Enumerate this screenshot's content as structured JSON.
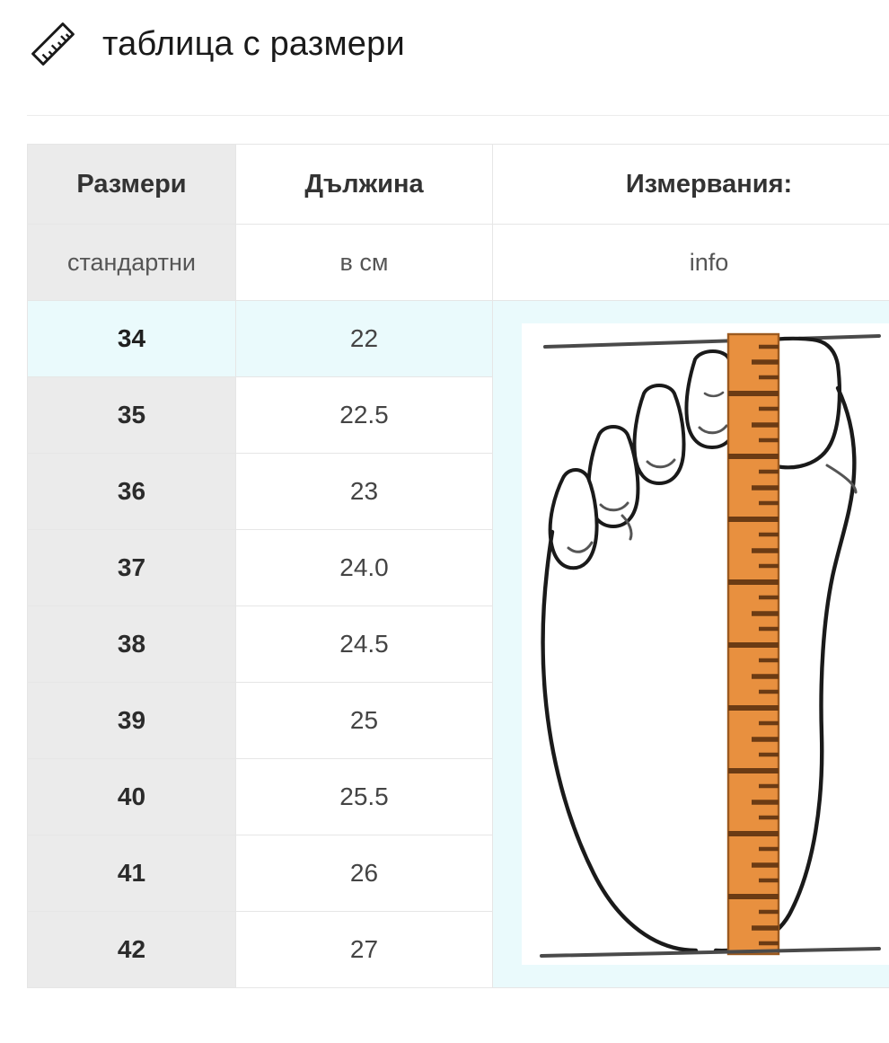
{
  "header": {
    "icon": "ruler-icon",
    "title": "таблица с размери"
  },
  "colors": {
    "highlight_row": "#eafafc",
    "size_column": "#ebebeb",
    "border": "#e6e6e6",
    "ruler_orange": "#e8903f",
    "ruler_tick": "#6b3b14",
    "foot_outline": "#1a1a1a",
    "text_dark": "#333333",
    "text_muted": "#555555"
  },
  "table": {
    "headers": [
      "Размери",
      "Дължина",
      "Измервания:"
    ],
    "subheaders": [
      "стандартни",
      "в см",
      "info"
    ],
    "highlighted_size": "34",
    "rows": [
      {
        "size": "34",
        "length": "22"
      },
      {
        "size": "35",
        "length": "22.5"
      },
      {
        "size": "36",
        "length": "23"
      },
      {
        "size": "37",
        "length": "24.0"
      },
      {
        "size": "38",
        "length": "24.5"
      },
      {
        "size": "39",
        "length": "25"
      },
      {
        "size": "40",
        "length": "25.5"
      },
      {
        "size": "41",
        "length": "26"
      },
      {
        "size": "42",
        "length": "27"
      }
    ],
    "measurement_image": {
      "name": "foot-measurement-diagram",
      "description": "Top-down line drawing of a bare left foot with an orange ruler laid lengthwise along the foot, between horizontal reference lines at the toe and heel"
    }
  }
}
